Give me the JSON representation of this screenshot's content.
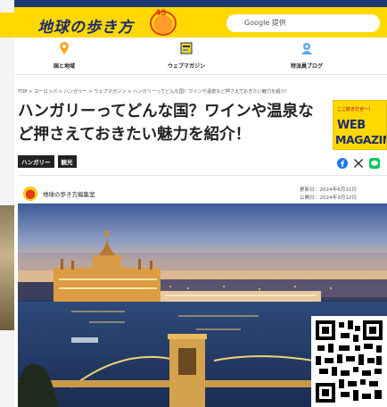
{
  "header": {
    "logo_text": "地球の歩き方",
    "anniversary": "45",
    "search_label": "Google 提供"
  },
  "nav": {
    "items": [
      {
        "label": "国と地域",
        "icon": "pin-icon"
      },
      {
        "label": "ウェブマガジン",
        "icon": "magazine-icon"
      },
      {
        "label": "特派員ブログ",
        "icon": "reporter-icon"
      }
    ]
  },
  "breadcrumb": "TOP > ヨーロッパ > ハンガリー > ウェブマガジン > ハンガリーってどんな国？ワインや温泉など押さえておきたい魅力を紹介！",
  "article": {
    "title": "ハンガリーってどんな国？ワインや温泉など押さえておきたい魅力を紹介！",
    "tags": [
      "ハンガリー",
      "観光"
    ],
    "author": "地球の歩き方編集室",
    "updated": "更新日：2024年6月11日",
    "published": "公開日：2024年3月12日"
  },
  "banner": {
    "top_text": "ここ好きだぜー！",
    "line1": "WEB",
    "line2": "MAGAZINE"
  },
  "share": [
    "facebook-icon",
    "x-icon",
    "line-icon"
  ],
  "colors": {
    "brand_yellow": "#ffd800",
    "brand_navy": "#1d2b6f",
    "frame": "#1d3a73"
  }
}
